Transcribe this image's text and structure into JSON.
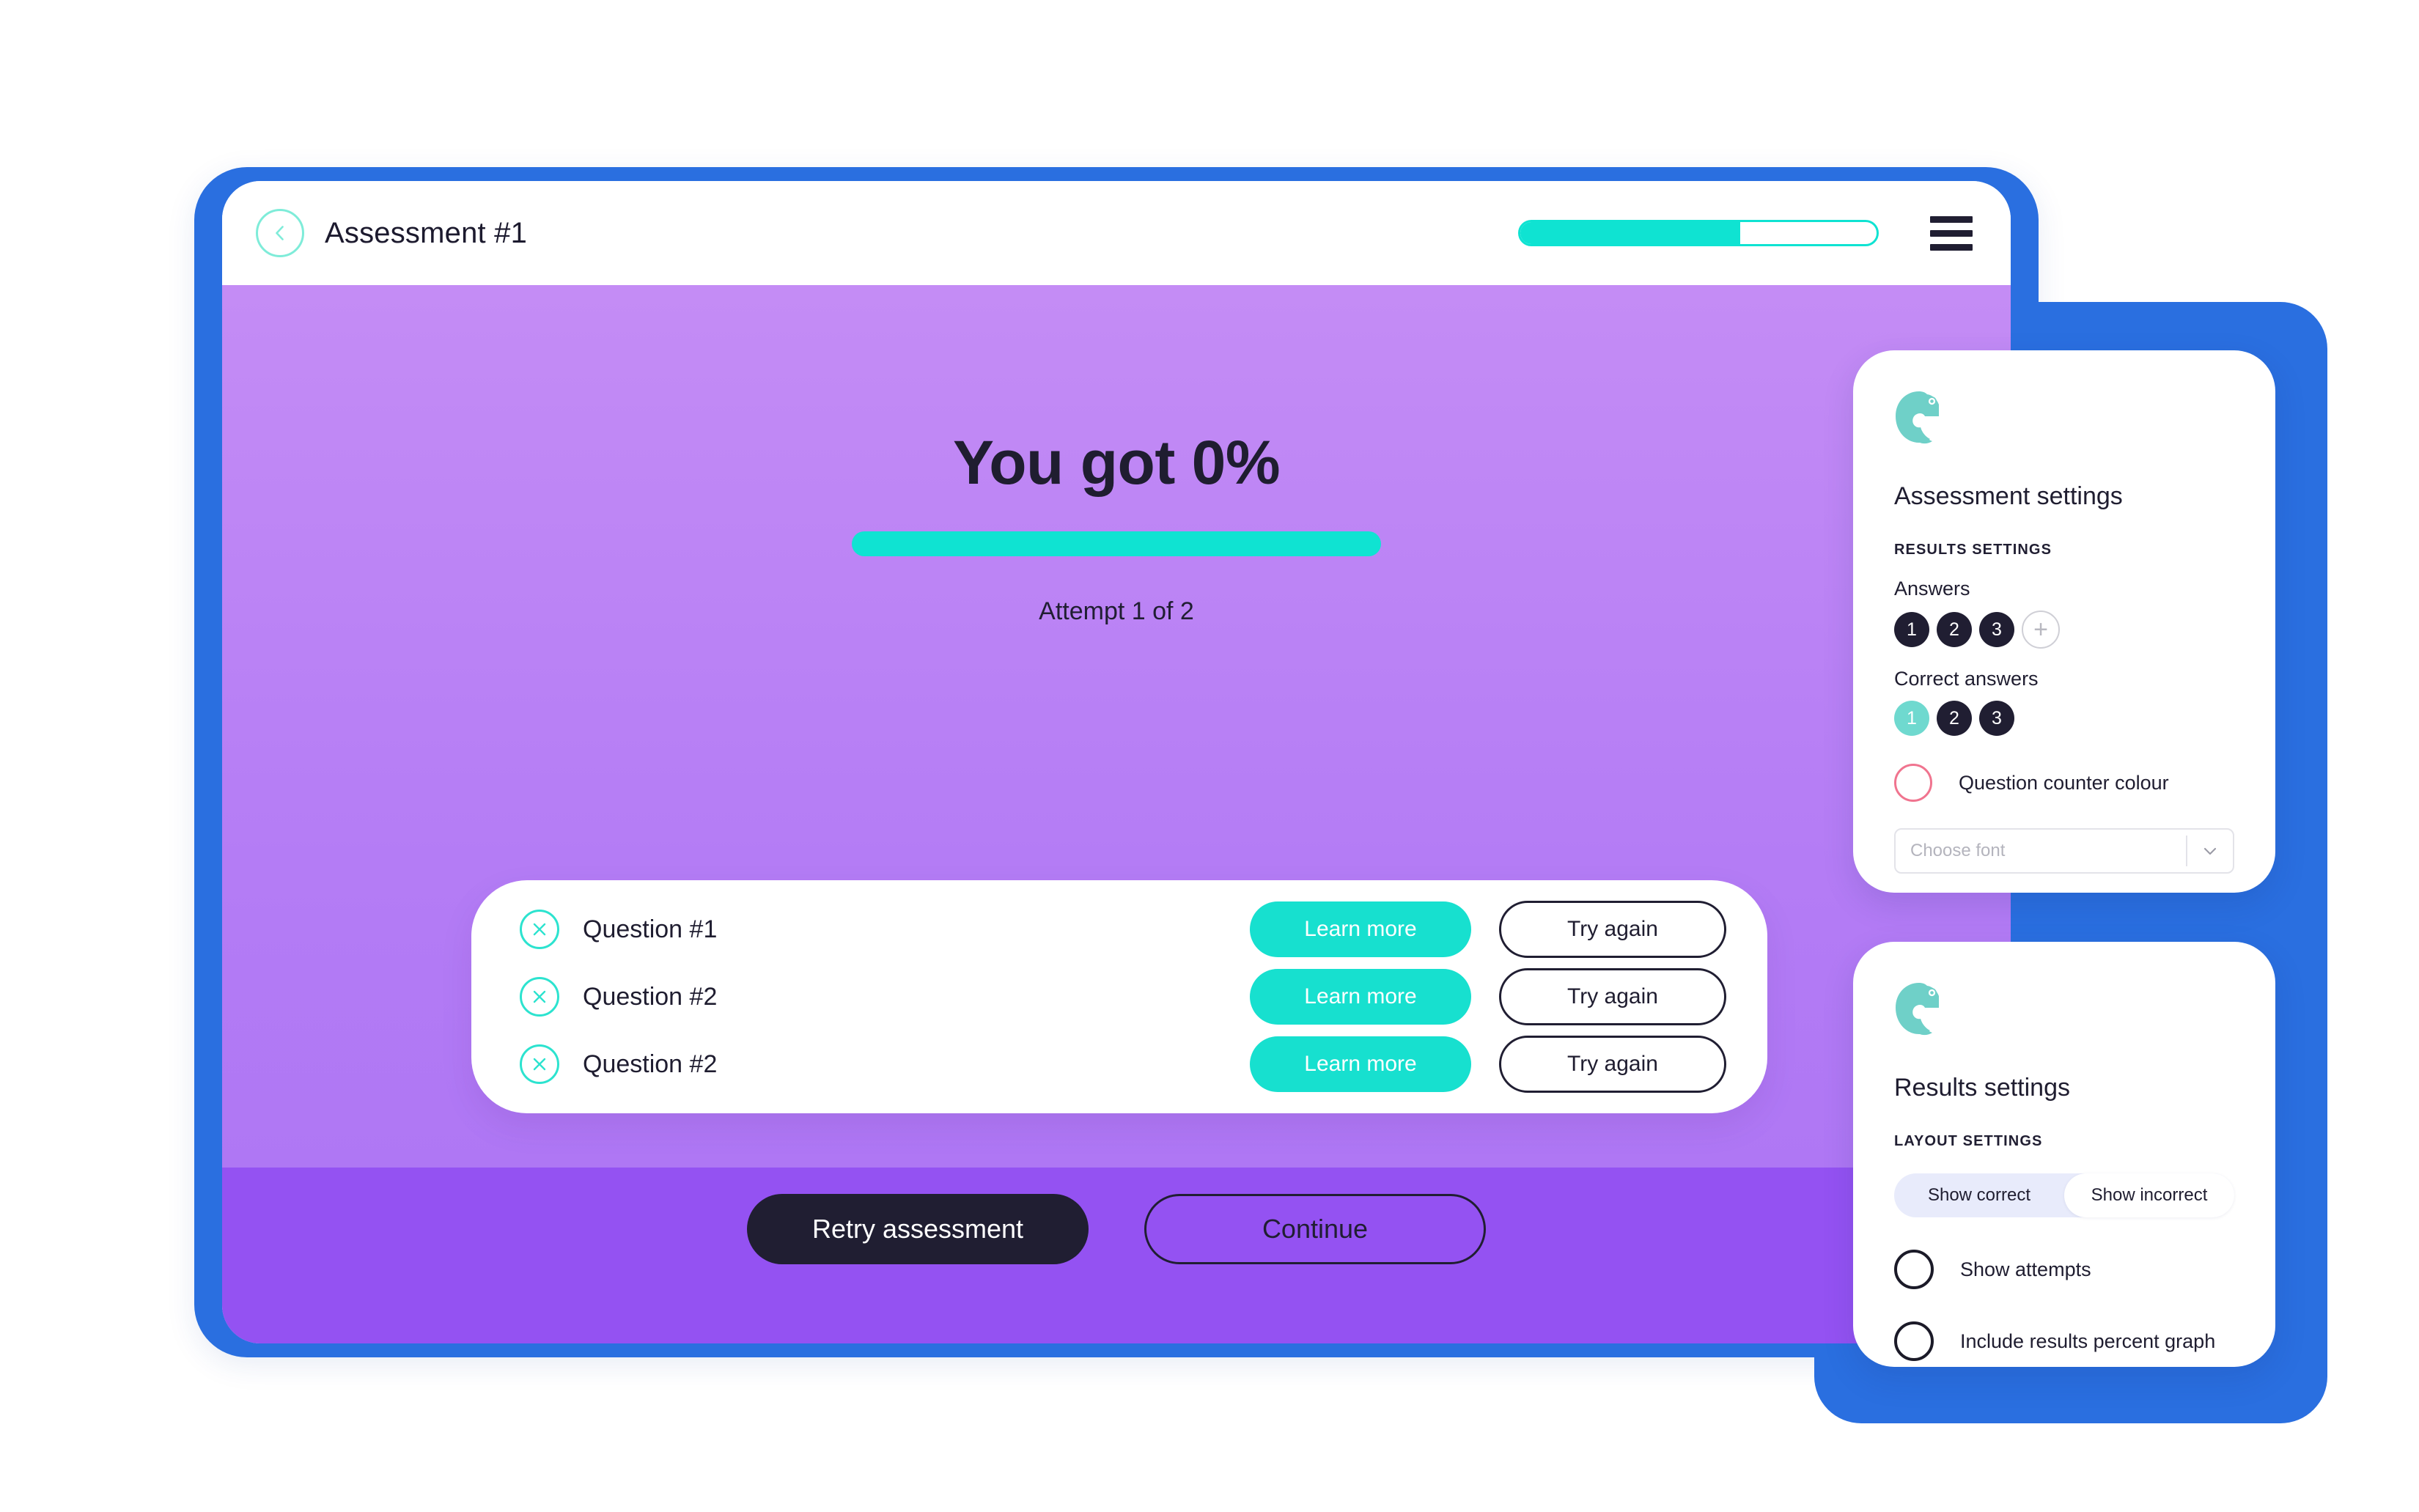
{
  "theme": {
    "frame_blue": "#2a6fe0",
    "accent_teal": "#0fe3d2",
    "logo_teal": "#6fd0c8",
    "dark": "#201e32",
    "purple_top": "#c48cf5",
    "purple_bottom": "#9452f2",
    "pink": "#f0748f",
    "segment_track": "#e8ebfb"
  },
  "app": {
    "topbar": {
      "back_icon": "chevron-left-icon",
      "title": "Assessment #1",
      "progress_percent": 62,
      "menu_icon": "hamburger-menu-icon"
    },
    "results": {
      "score_title": "You got 0%",
      "score_percent": 0,
      "attempt_text": "Attempt 1 of 2",
      "questions": [
        {
          "status_icon": "cross-circle-icon",
          "label": "Question #1",
          "learn_more": "Learn more",
          "try_again": "Try again"
        },
        {
          "status_icon": "cross-circle-icon",
          "label": "Question #2",
          "learn_more": "Learn more",
          "try_again": "Try again"
        },
        {
          "status_icon": "cross-circle-icon",
          "label": "Question #2",
          "learn_more": "Learn more",
          "try_again": "Try again"
        }
      ],
      "retry_label": "Retry assessment",
      "continue_label": "Continue"
    }
  },
  "assessment_settings": {
    "logo_icon": "chameleon-logo-icon",
    "title": "Assessment settings",
    "section_label": "RESULTS SETTINGS",
    "answers_label": "Answers",
    "answers": [
      "1",
      "2",
      "3"
    ],
    "add_icon": "plus-icon",
    "correct_answers_label": "Correct answers",
    "correct_answers": [
      "1",
      "2",
      "3"
    ],
    "correct_selected_index": 0,
    "question_counter_colour_label": "Question counter colour",
    "question_counter_colour": "#f0748f",
    "font_select_placeholder": "Choose font",
    "font_select_value": "",
    "font_select_caret_icon": "chevron-down-icon"
  },
  "results_settings": {
    "logo_icon": "chameleon-logo-icon",
    "title": "Results settings",
    "section_label": "LAYOUT SETTINGS",
    "segments": [
      "Show correct",
      "Show incorrect"
    ],
    "segment_active_index": 1,
    "toggles": [
      {
        "label": "Show attempts",
        "checked": false
      },
      {
        "label": "Include results percent graph",
        "checked": false
      }
    ]
  }
}
